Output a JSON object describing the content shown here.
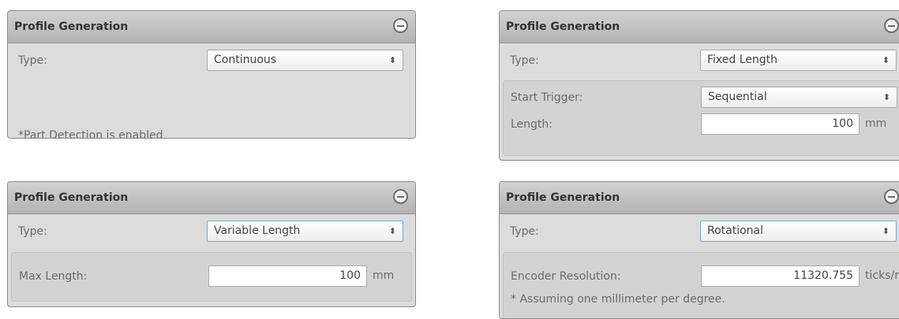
{
  "panels": [
    {
      "title": "Profile Generation",
      "type_label": "Type:",
      "type_value": "Continuous",
      "note": "*Part Detection is enabled"
    },
    {
      "title": "Profile Generation",
      "type_label": "Type:",
      "type_value": "Fixed Length",
      "start_trigger_label": "Start Trigger:",
      "start_trigger_value": "Sequential",
      "length_label": "Length:",
      "length_value": "100",
      "length_unit": "mm"
    },
    {
      "title": "Profile Generation",
      "type_label": "Type:",
      "type_value": "Variable Length",
      "max_length_label": "Max Length:",
      "max_length_value": "100",
      "max_length_unit": "mm"
    },
    {
      "title": "Profile Generation",
      "type_label": "Type:",
      "type_value": "Rotational",
      "encoder_label": "Encoder Resolution:",
      "encoder_value": "11320.755",
      "encoder_unit": "ticks/rev",
      "note": "* Assuming one millimeter per degree."
    }
  ],
  "icons": {
    "collapse": "collapse-icon",
    "select_arrow": "updown-arrow-icon"
  }
}
